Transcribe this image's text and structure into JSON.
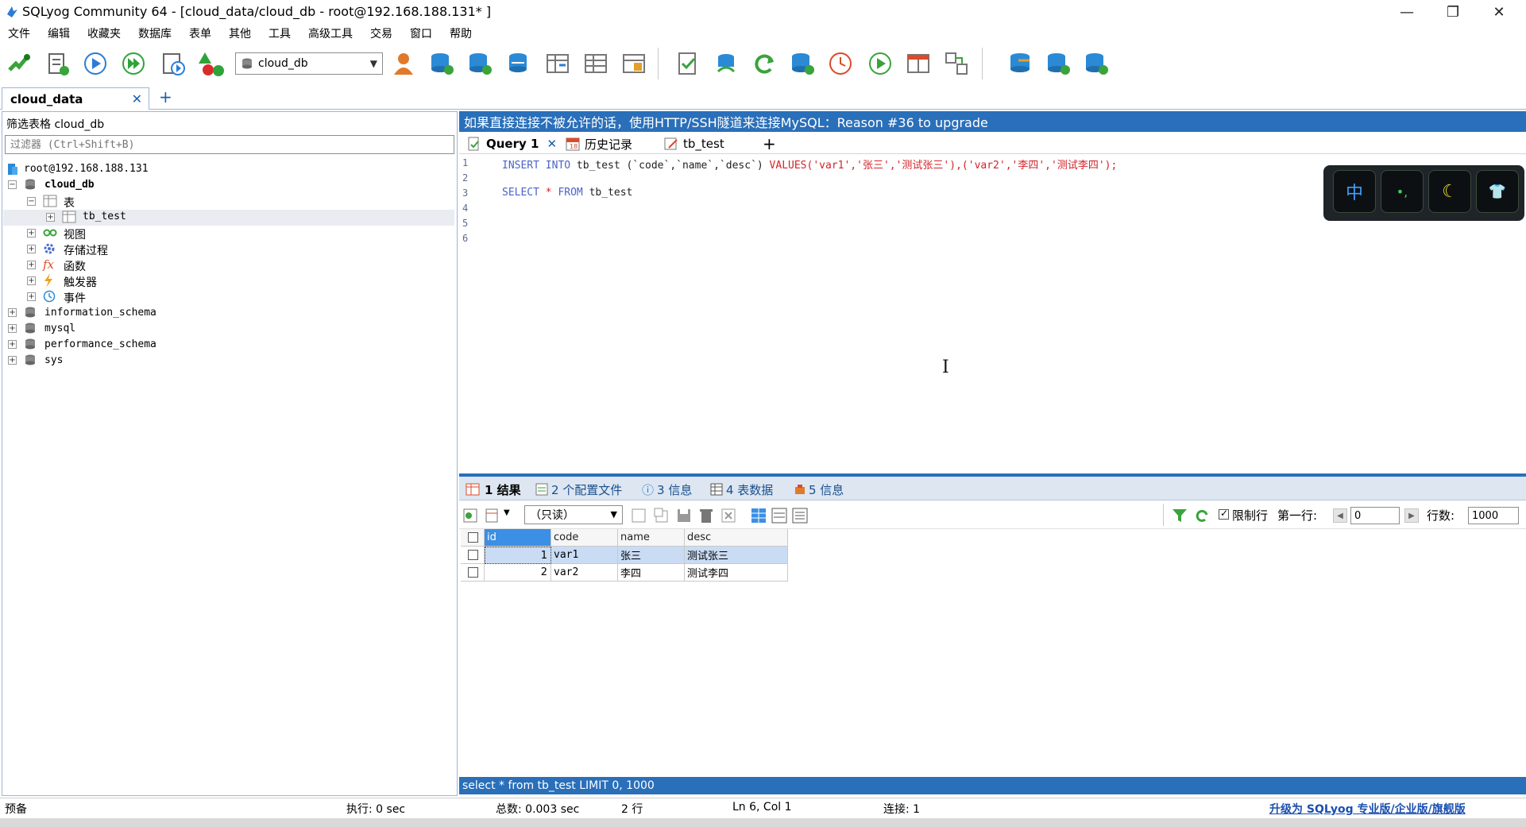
{
  "window": {
    "title": "SQLyog Community 64 - [cloud_data/cloud_db - root@192.168.188.131* ]",
    "minimize_glyph": "—",
    "restore_glyph": "❐",
    "close_glyph": "✕"
  },
  "menu": [
    "文件",
    "编辑",
    "收藏夹",
    "数据库",
    "表单",
    "其他",
    "工具",
    "高级工具",
    "交易",
    "窗口",
    "帮助"
  ],
  "toolbar": {
    "database_select": "cloud_db"
  },
  "connection_tab": {
    "label": "cloud_data",
    "close": "✕",
    "add": "+"
  },
  "left_panel": {
    "filter_label": "筛选表格 cloud_db",
    "filter_placeholder": "过滤器 (Ctrl+Shift+B)",
    "tree": {
      "server": "root@192.168.188.131",
      "database": "cloud_db",
      "tables_folder": "表",
      "table": "tb_test",
      "views": "视图",
      "procedures": "存储过程",
      "functions": "函数",
      "triggers": "触发器",
      "events": "事件",
      "other_dbs": [
        "information_schema",
        "mysql",
        "performance_schema",
        "sys"
      ]
    }
  },
  "banner": "如果直接连接不被允许的话，使用HTTP/SSH隧道来连接MySQL：Reason #36 to upgrade",
  "query_tabs": {
    "query": "Query 1",
    "history": "历史记录",
    "table": "tb_test",
    "add": "+"
  },
  "editor": {
    "line_numbers": [
      "1",
      "2",
      "3",
      "4",
      "5",
      "6"
    ],
    "line1": {
      "insert": "INSERT INTO",
      "table": " tb_test (`code`,`name`,`desc`) ",
      "values": "VALUES",
      "vals": "('var1','张三','测试张三'),('var2','李四','测试李四');"
    },
    "line3": {
      "select": "SELECT",
      "star": " * ",
      "from": "FROM",
      "table": " tb_test"
    }
  },
  "ime": {
    "lang": "中",
    "punct": "•,",
    "moon": "☾",
    "skin": "👕"
  },
  "result_tabs": {
    "result": "1 结果",
    "profile": "2 个配置文件",
    "info": "3 信息",
    "table_data": "4 表数据",
    "info2": "5 信息"
  },
  "result_toolbar": {
    "mode": "（只读）",
    "limit_label": "限制行",
    "first_row_label": "第一行:",
    "first_row_value": "0",
    "rows_label": "行数:",
    "rows_value": "1000"
  },
  "grid": {
    "columns": [
      "id",
      "code",
      "name",
      "desc"
    ],
    "rows": [
      {
        "id": "1",
        "code": "var1",
        "name": "张三",
        "desc": "测试张三"
      },
      {
        "id": "2",
        "code": "var2",
        "name": "李四",
        "desc": "测试李四"
      }
    ]
  },
  "sql_status": "select * from tb_test LIMIT 0, 1000",
  "statusbar": {
    "ready": "预备",
    "exec": "执行: 0 sec",
    "total": "总数: 0.003 sec",
    "rows": "2 行",
    "position": "Ln 6, Col 1",
    "connections": "连接: 1",
    "upgrade": "升级为 SQLyog 专业版/企业版/旗舰版"
  },
  "colors": {
    "accent": "#2a6fb9",
    "selection": "#3b8fe4",
    "keyword": "#4a63c8",
    "string": "#d2232a"
  }
}
